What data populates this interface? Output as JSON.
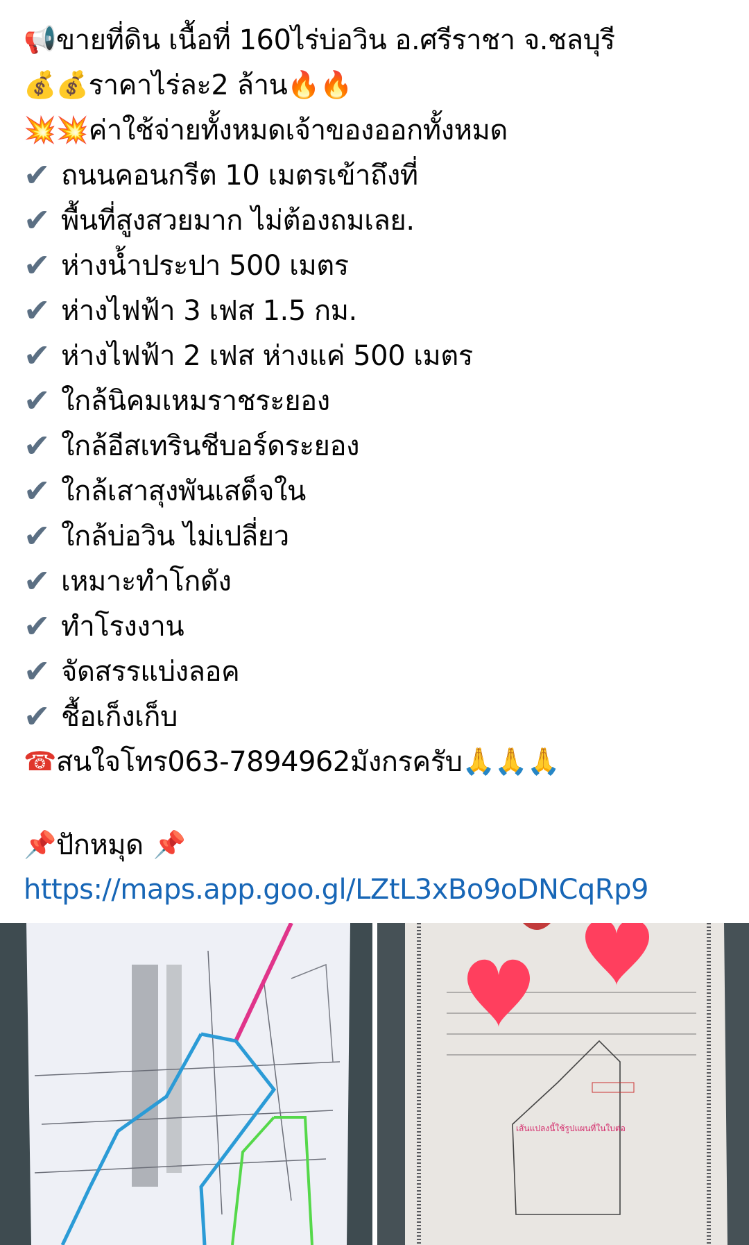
{
  "post": {
    "headline": {
      "icon": "megaphone-icon",
      "text": "ขายที่ดิน เนื้อที่ 160ไร่บ่อวิน อ.ศรีราชา จ.ชลบุรี"
    },
    "price": {
      "icon": "money-bag-icon",
      "text": "ราคาไร่ละ2 ล้าน",
      "trailing_icon": "fire-icon"
    },
    "costs": {
      "icon": "explosion-icon",
      "text": "ค่าใช้จ่ายทั้งหมดเจ้าของออกทั้งหมด"
    },
    "features": [
      "ถนนคอนกรีต 10 เมตรเข้าถึงที่",
      "พื้นที่สูงสวยมาก ไม่ต้องถมเลย.",
      "ห่างน้ำประปา 500 เมตร",
      "ห่างไฟฟ้า 3 เฟส 1.5 กม.",
      "ห่างไฟฟ้า 2 เฟส ห่างแค่ 500 เมตร",
      "ใกล้นิคมเหมราชระยอง",
      "ใกล้อีสเทรินชีบอร์ดระยอง",
      "ใกล้เสาสุงพันเสด็จใน",
      "ใกล้บ่อวิน ไม่เปลี่ยว",
      "เหมาะทำโกดัง",
      "ทำโรงงาน",
      "จัดสรรแบ่งลอค",
      "ชื้อเก็งเก็บ"
    ],
    "contact": {
      "icon": "telephone-icon",
      "text": "สนใจโทร063-7894962มังกรครับ",
      "trailing_icon": "praying-hands-icon"
    },
    "pin": {
      "icon": "pushpin-icon",
      "text": "ปักหมุด"
    },
    "map_link": "https://maps.app.goo.gl/LZtL3xBo9oDNCqRp9"
  },
  "photos": [
    {
      "name": "land-map-photo"
    },
    {
      "name": "land-deed-photo"
    }
  ]
}
